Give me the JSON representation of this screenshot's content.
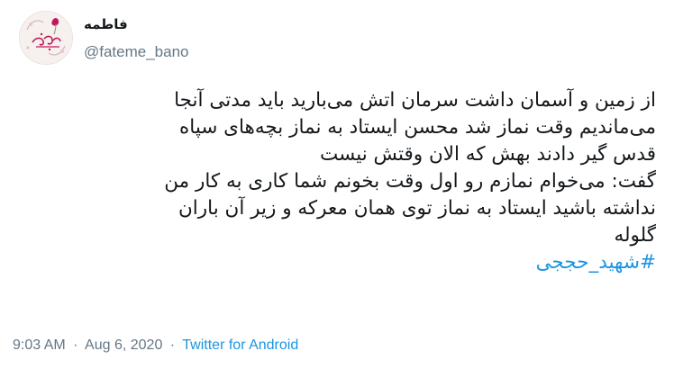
{
  "user": {
    "display_name": "فاطمه",
    "handle": "@fateme_bano"
  },
  "tweet": {
    "lines": [
      "از زمین و آسمان داشت سرمان اتش می‌بارید  باید مدتی آنجا",
      "می‌ماندیم وقت نماز شد محسن ایستاد به نماز  بچه‌های سپاه",
      "قدس گیر دادند بهش که الان وقتش نیست",
      "گفت: می‌خوام نمازم رو اول وقت بخونم شما کاری به کار من",
      "نداشته باشید ایستاد به نماز توی همان معرکه و زیر آن باران",
      "گلوله"
    ],
    "hashtag": "#شهید_حججی"
  },
  "meta": {
    "time": "9:03 AM",
    "separator": "·",
    "date": "Aug 6, 2020",
    "source": "Twitter for Android"
  },
  "colors": {
    "link": "#1b95e0",
    "secondary_text": "#657786",
    "primary_text": "#14171a",
    "avatar_accent": "#c2185b"
  }
}
